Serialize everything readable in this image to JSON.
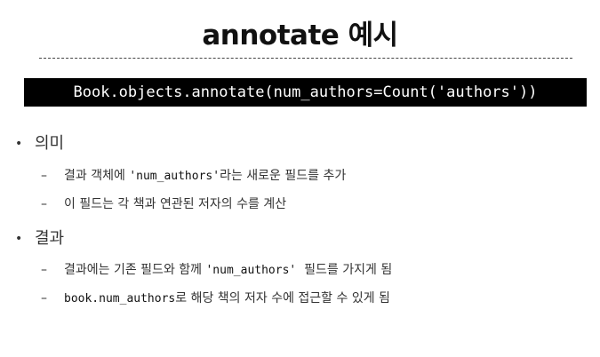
{
  "slide": {
    "title": "annotate 예시",
    "code": "Book.objects.annotate(num_authors=Count('authors'))",
    "sections": [
      {
        "bullet": "•",
        "heading": "의미",
        "items": [
          {
            "dash": "–",
            "pre": "결과 객체에 ",
            "code": "'num_authors'",
            "post": "라는 새로운 필드를 추가"
          },
          {
            "dash": "–",
            "pre": "이 필드는 각 책과 연관된 저자의 수를 계산",
            "code": "",
            "post": ""
          }
        ]
      },
      {
        "bullet": "•",
        "heading": "결과",
        "items": [
          {
            "dash": "–",
            "pre": "결과에는 기존 필드와 함께 ",
            "code": "'num_authors'",
            "post": "  필드를 가지게 됨"
          },
          {
            "dash": "–",
            "pre": "",
            "code": "book.num_authors",
            "post": "로 해당 책의 저자 수에 접근할 수 있게 됨"
          }
        ]
      }
    ]
  }
}
